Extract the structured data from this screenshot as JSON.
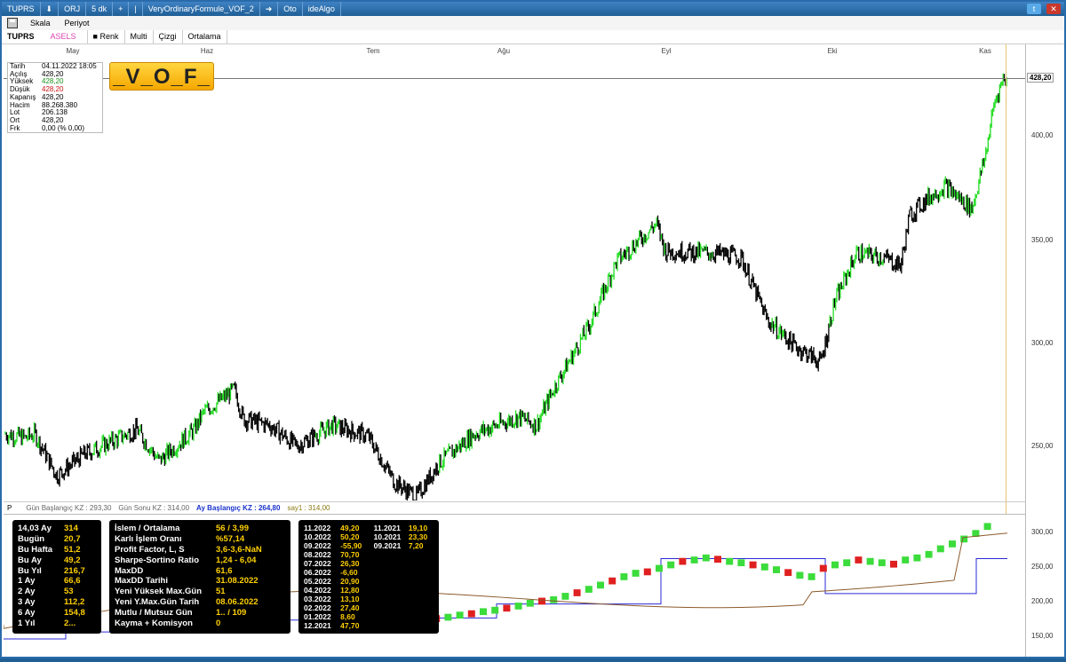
{
  "titlebar": {
    "symbol": "TUPRS",
    "down_arrow": "⬇",
    "orj": "ORJ",
    "period": "5 dk",
    "plus": "+",
    "pipe": "|",
    "formula": "VeryOrdinaryFormule_VOF_2",
    "arrow": "➜",
    "oto": "Oto",
    "idealgo": "ideAlgo",
    "tw": "t"
  },
  "toolbar": {
    "skala": "Skala",
    "periyot": "Periyot"
  },
  "tabs": [
    "TUPRS",
    "ASELS",
    "Renk",
    "Multi",
    "Çizgi",
    "Ortalama"
  ],
  "months": [
    "May",
    "Haz",
    "Tem",
    "Ağu",
    "Eyl",
    "Eki",
    "Kas"
  ],
  "yaxis": [
    "400,00",
    "350,00",
    "300,00",
    "250,00"
  ],
  "price_label": "428,20",
  "sub_yaxis": [
    "300,00",
    "250,00",
    "200,00",
    "150,00"
  ],
  "info": [
    {
      "k": "Tarih",
      "v": "04.11.2022 18:05",
      "c": ""
    },
    {
      "k": "Açılış",
      "v": "428,20",
      "c": ""
    },
    {
      "k": "Yüksek",
      "v": "428,20",
      "c": "green"
    },
    {
      "k": "Düşük",
      "v": "428,20",
      "c": "red"
    },
    {
      "k": "Kapanış",
      "v": "428,20",
      "c": ""
    },
    {
      "k": "Hacim",
      "v": "88.268.380",
      "c": ""
    },
    {
      "k": "Lot",
      "v": "206.138",
      "c": ""
    },
    {
      "k": "Ort",
      "v": "428,20",
      "c": ""
    },
    {
      "k": "Frk",
      "v": "0,00 (% 0,00)",
      "c": ""
    }
  ],
  "vof_label": "_V_O_F_",
  "legend": {
    "p": "P",
    "gun_bas": "Gün Başlangıç KZ :  293,30",
    "gun_son": "Gün Sonu KZ :  314,00",
    "ay_bas": "Ay Başlangıç KZ :  264,80",
    "say1": "say1 :  314,00"
  },
  "panel1": [
    {
      "k": "14,03 Ay",
      "v": "314"
    },
    {
      "k": "Bugün",
      "v": "20,7"
    },
    {
      "k": "Bu Hafta",
      "v": "51,2"
    },
    {
      "k": "Bu Ay",
      "v": "49,2"
    },
    {
      "k": "Bu Yıl",
      "v": "216,7"
    },
    {
      "k": "1 Ay",
      "v": "66,6"
    },
    {
      "k": "2 Ay",
      "v": "53"
    },
    {
      "k": "3 Ay",
      "v": "112,2"
    },
    {
      "k": "6 Ay",
      "v": "154,8"
    },
    {
      "k": "1 Yıl",
      "v": "2..."
    }
  ],
  "panel2": [
    {
      "k": "İslem / Ortalama",
      "v": "56 / 3,99"
    },
    {
      "k": "Karlı İşlem Oranı",
      "v": "%57,14"
    },
    {
      "k": "Profit Factor, L, S",
      "v": "3,6-3,6-NaN"
    },
    {
      "k": "Sharpe-Sortino Ratio",
      "v": "1,24 - 6,04"
    },
    {
      "k": "MaxDD",
      "v": "61,6"
    },
    {
      "k": "MaxDD Tarihi",
      "v": "31.08.2022"
    },
    {
      "k": "Yeni Yüksek Max.Gün",
      "v": "51"
    },
    {
      "k": "Yeni Y.Max.Gün Tarih",
      "v": "08.06.2022"
    },
    {
      "k": "Mutlu / Mutsuz Gün",
      "v": "1.. / 109"
    },
    {
      "k": "Kayma + Komisyon",
      "v": "0"
    }
  ],
  "panel3": [
    [
      "11.2022",
      "49,20",
      "11.2021",
      "19,10"
    ],
    [
      "10.2022",
      "50,20",
      "10.2021",
      "23,30"
    ],
    [
      "09.2022",
      "-55,90",
      "09.2021",
      "7,20"
    ],
    [
      "08.2022",
      "70,70",
      "",
      ""
    ],
    [
      "07.2022",
      "26,30",
      "",
      ""
    ],
    [
      "06.2022",
      "-6,60",
      "",
      ""
    ],
    [
      "05.2022",
      "20,90",
      "",
      ""
    ],
    [
      "04.2022",
      "12,80",
      "",
      ""
    ],
    [
      "03.2022",
      "13,10",
      "",
      ""
    ],
    [
      "02.2022",
      "27,40",
      "",
      ""
    ],
    [
      "01.2022",
      "8,60",
      "",
      ""
    ],
    [
      "12.2021",
      "47,70",
      "",
      ""
    ]
  ],
  "chart_data": {
    "type": "line",
    "x": [
      "May",
      "Haz",
      "Tem",
      "Ağu",
      "Eyl",
      "Eki",
      "Kas"
    ],
    "series": [
      {
        "values": [
          250,
          290,
          240,
          300,
          360,
          310,
          428.2
        ]
      }
    ],
    "ylim": [
      230,
      440
    ]
  },
  "colors": {
    "up": "#22dd22",
    "down": "#000000",
    "accent": "#1f5f96"
  }
}
